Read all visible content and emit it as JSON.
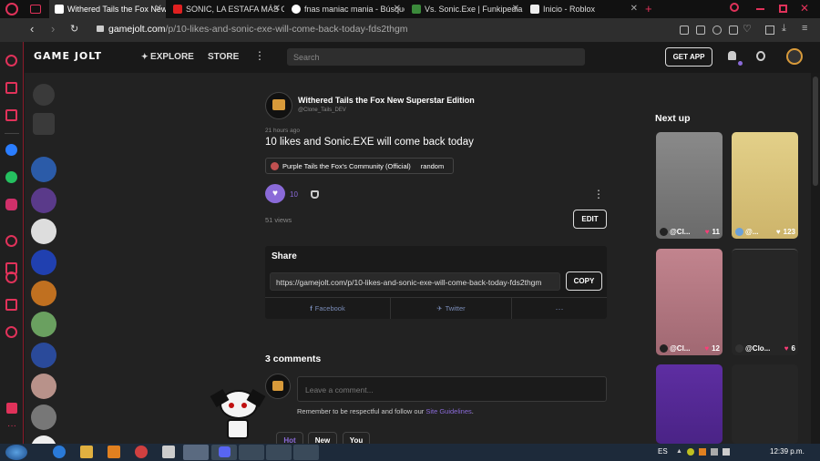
{
  "tabs": [
    {
      "title": "Withered Tails the Fox New Supe",
      "active": true
    },
    {
      "title": "SONIC, LA ESTAFA MÁS GRANDE"
    },
    {
      "title": "fnas maniac mania - Búsqueda"
    },
    {
      "title": "Vs. Sonic.Exe | Funkipedia Mods"
    },
    {
      "title": "Inicio - Roblox"
    }
  ],
  "address": {
    "host": "gamejolt.com",
    "path": "/p/10-likes-and-sonic-exe-will-come-back-today-fds2thgm"
  },
  "gj_nav": {
    "logo": "GAME JOLT",
    "explore": "EXPLORE",
    "store": "STORE",
    "search_placeholder": "Search",
    "get_app": "GET APP"
  },
  "post": {
    "author_name": "Withered Tails the Fox New Superstar Edition",
    "author_handle": "@Clone_Tails_DEV",
    "time_ago": "21 hours ago",
    "title": "10 likes and Sonic.EXE will come back today",
    "community": "Purple Tails the Fox's Community (Official)",
    "channel": "random",
    "like_count": "10",
    "views": "51 views",
    "edit_label": "EDIT"
  },
  "share": {
    "heading": "Share",
    "url": "https://gamejolt.com/p/10-likes-and-sonic-exe-will-come-back-today-fds2thgm",
    "copy_label": "COPY",
    "facebook": "Facebook",
    "twitter": "Twitter",
    "more": "···"
  },
  "comments": {
    "heading": "3 comments",
    "placeholder": "Leave a comment...",
    "note_prefix": "Remember to be respectful and follow our ",
    "note_link": "Site Guidelines",
    "note_suffix": ".",
    "sort_hot": "Hot",
    "sort_new": "New",
    "sort_you": "You"
  },
  "next_up": {
    "heading": "Next up",
    "cards": [
      {
        "user": "@Cl...",
        "likes": "11",
        "color": "#8a8a8a"
      },
      {
        "user": "@...",
        "likes": "123",
        "color": "#e0cc7e"
      },
      {
        "user": "@Cl...",
        "likes": "12",
        "color": "#b87a84"
      },
      {
        "user": "@Clo...",
        "likes": "6",
        "color": "#262626"
      },
      {
        "user": "",
        "likes": "",
        "color": "#5a2c9a"
      },
      {
        "user": "",
        "likes": "",
        "color": "#262626"
      }
    ]
  },
  "taskbar": {
    "language": "ES",
    "time": "12:39 p.m."
  },
  "colors": {
    "accent_purple": "#8a6ad8",
    "heart_pink": "#ff3c78",
    "opera_red": "#e0325a"
  },
  "icons": [
    "opera-logo-icon",
    "back-icon",
    "forward-icon",
    "reload-icon",
    "lock-icon",
    "heart-icon",
    "share-icon",
    "bell-icon",
    "trophy-icon",
    "more-vertical-icon",
    "facebook-icon",
    "twitter-icon",
    "edit-icon"
  ]
}
